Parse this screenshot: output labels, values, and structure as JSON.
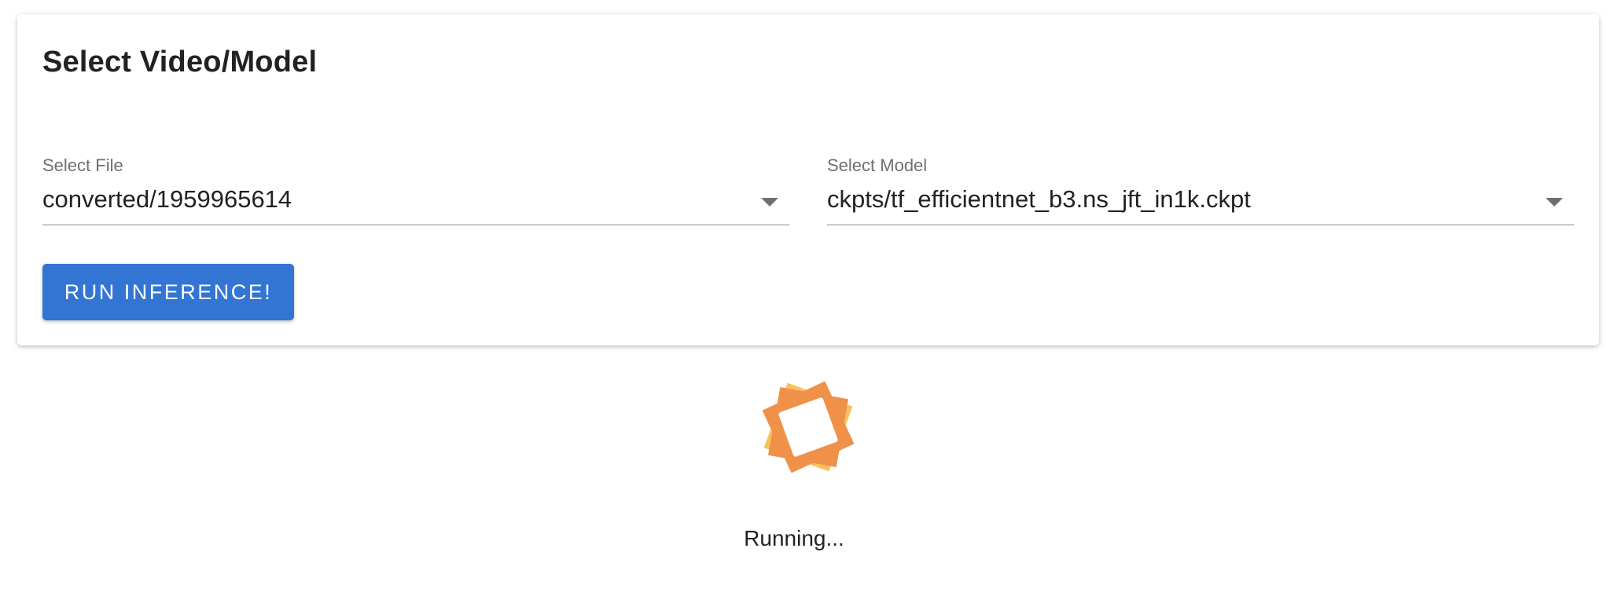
{
  "panel": {
    "title": "Select Video/Model"
  },
  "file_select": {
    "label": "Select File",
    "value": "converted/1959965614"
  },
  "model_select": {
    "label": "Select Model",
    "value": "ckpts/tf_efficientnet_b3.ns_jft_in1k.ckpt"
  },
  "run_button": {
    "label": "RUN INFERENCE!"
  },
  "status": {
    "text": "Running...",
    "spinner_color": "#f0914a",
    "spinner_highlight": "#f6c25a"
  },
  "colors": {
    "accent": "#3275d3"
  },
  "icons": {
    "dropdown": "chevron-down-icon",
    "loading": "loading-spinner-icon"
  }
}
